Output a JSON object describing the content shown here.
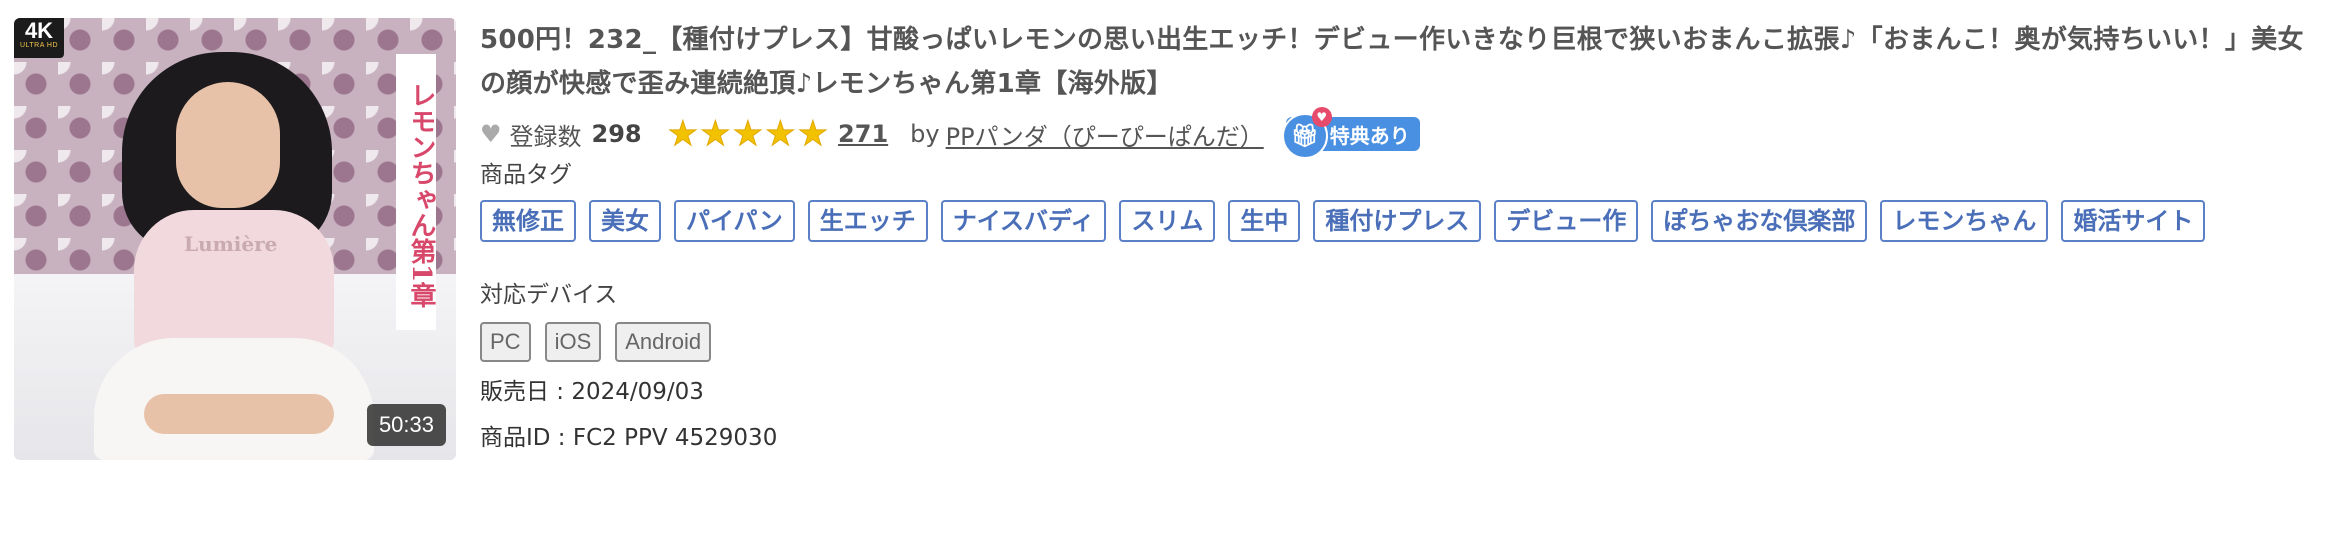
{
  "thumbnail": {
    "badge_big": "4K",
    "badge_small": "ULTRA HD",
    "vertical_title": "レモンちゃん第1章",
    "shirt_text": "Lumière",
    "duration": "50:33"
  },
  "product": {
    "title": "500円！232_【種付けプレス】甘酸っぱいレモンの思い出生エッチ！デビュー作いきなり巨根で狭いおまんこ拡張♪「おまんこ！奥が気持ちいい！」美女の顔が快感で歪み連続絶頂♪レモンちゃん第1章【海外版】",
    "registration_label": "登録数",
    "registration_count": "298",
    "rating_stars": 5,
    "rating_count": "271",
    "by_label": "by",
    "seller": "PPパンダ（ぴーぴーぱんだ）",
    "bonus_label": "特典あり"
  },
  "tags_label": "商品タグ",
  "tags": [
    "無修正",
    "美女",
    "パイパン",
    "生エッチ",
    "ナイスバディ",
    "スリム",
    "生中",
    "種付けプレス",
    "デビュー作",
    "ぽちゃおな倶楽部",
    "レモンちゃん",
    "婚活サイト"
  ],
  "devices_label": "対応デバイス",
  "devices": [
    "PC",
    "iOS",
    "Android"
  ],
  "release": {
    "label": "販売日 : ",
    "value": "2024/09/03"
  },
  "product_id": {
    "label": "商品ID : ",
    "value": "FC2 PPV 4529030"
  },
  "colors": {
    "tag_border": "#5a80c8",
    "star": "#f2c200",
    "bonus_bg": "#4a90e2"
  }
}
